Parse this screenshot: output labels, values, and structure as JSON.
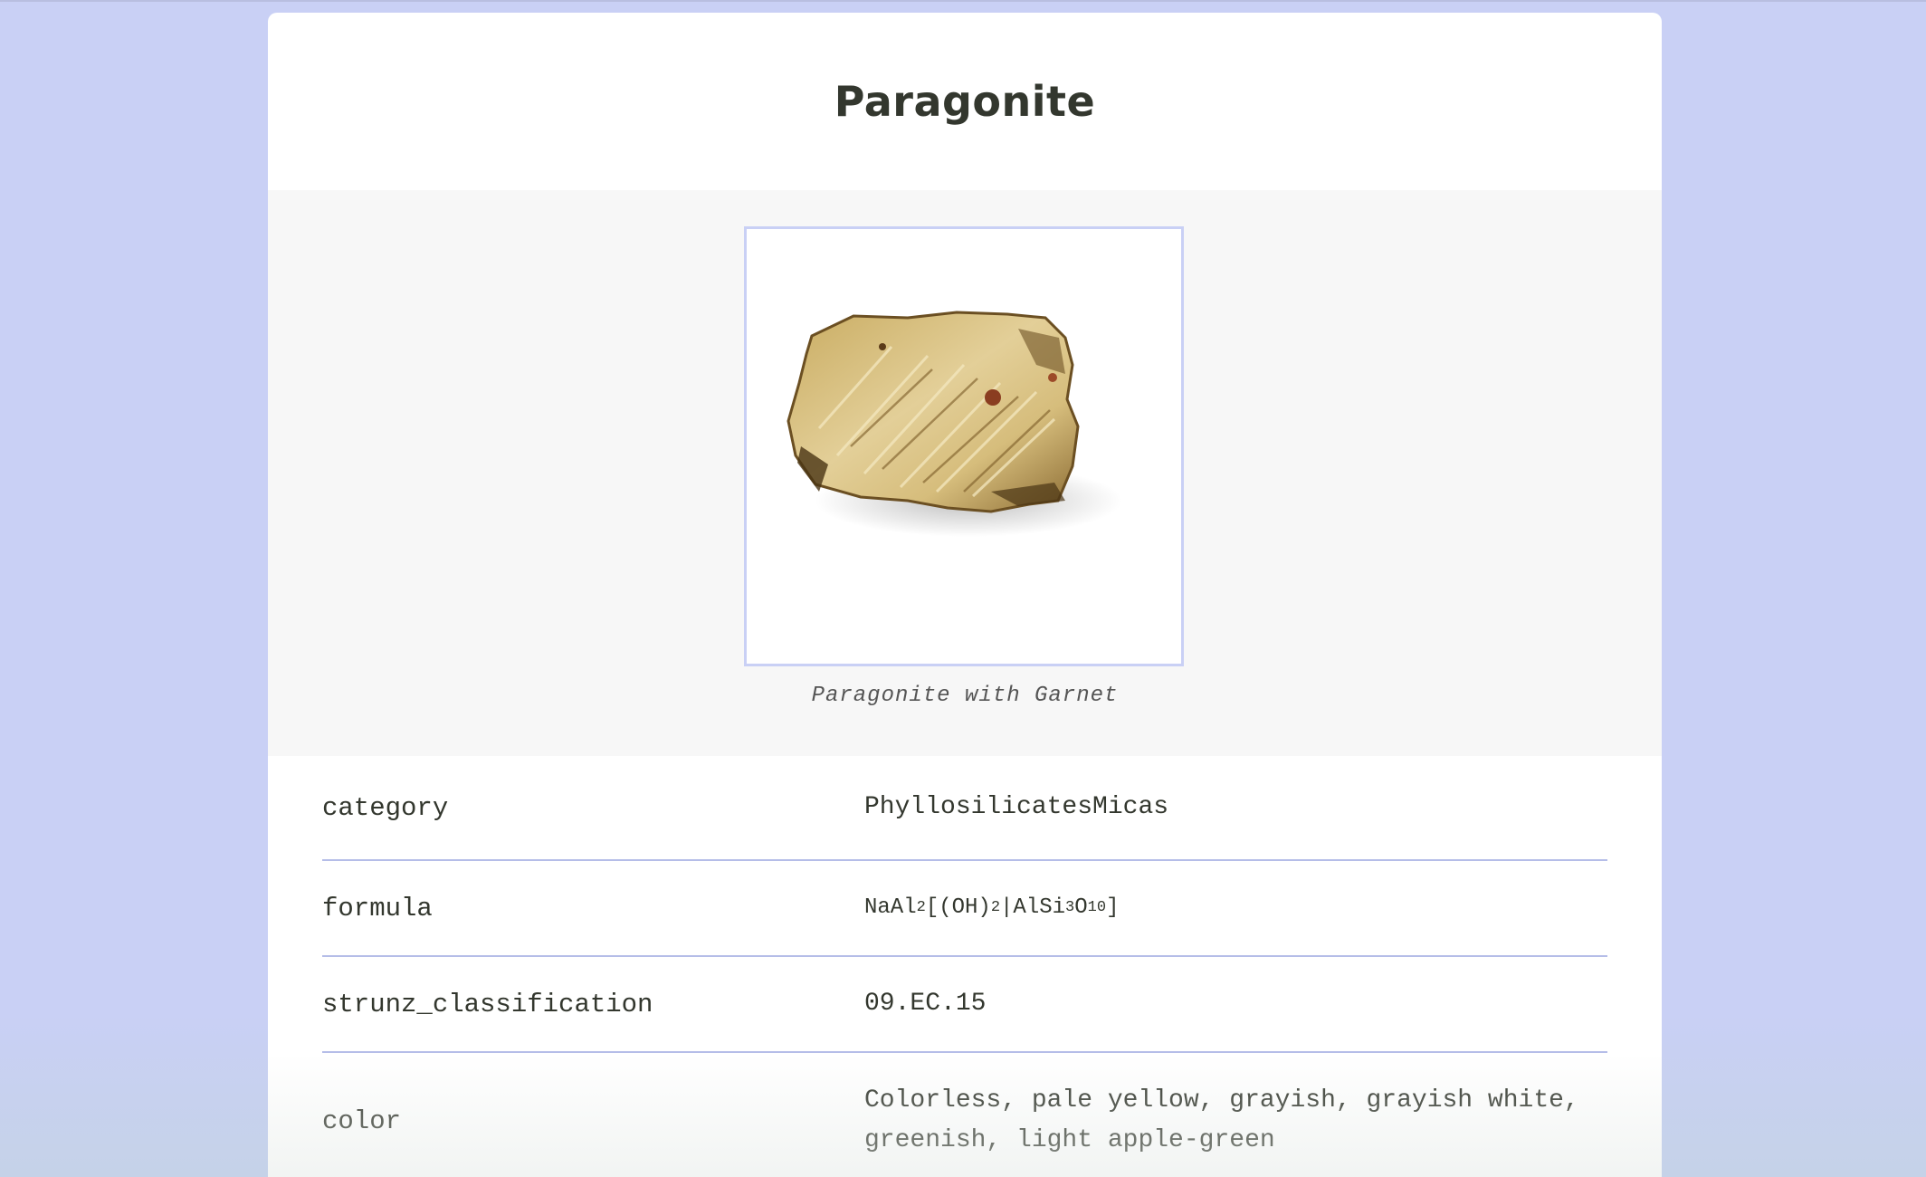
{
  "page": {
    "title": "Paragonite"
  },
  "figure": {
    "image_alt": "Paragonite with Garnet",
    "caption": "Paragonite with Garnet"
  },
  "properties": [
    {
      "key": "category",
      "value": "PhyllosilicatesMicas"
    },
    {
      "key": "formula",
      "value": "NaAl2[(OH)2|AlSi3O10]"
    },
    {
      "key": "strunz_classification",
      "value": "09.EC.15"
    },
    {
      "key": "color",
      "value": "Colorless, pale yellow, grayish, grayish white, greenish, light apple-green"
    }
  ],
  "colors": {
    "page_background": "#c9d0f5",
    "card_background": "#ffffff",
    "figure_background": "#f7f7f7",
    "accent_border": "#c9d0f5",
    "row_divider": "#b5bde8",
    "text": "#33372e"
  }
}
